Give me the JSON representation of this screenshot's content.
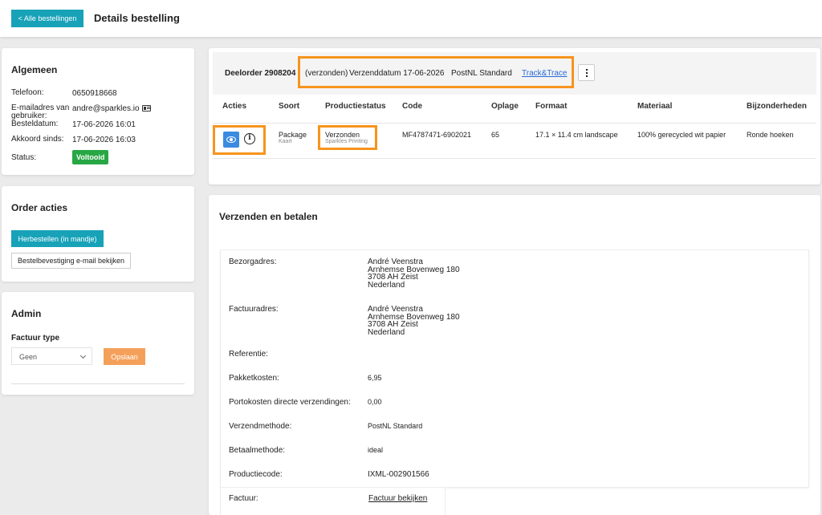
{
  "header": {
    "back_label": "< Alle bestellingen",
    "title": "Details bestelling"
  },
  "algemeen": {
    "title": "Algemeen",
    "telefoon_label": "Telefoon:",
    "telefoon": "0650918668",
    "email_label": "E-mailadres van gebruiker:",
    "email": "andre@sparkles.io",
    "besteldatum_label": "Besteldatum:",
    "besteldatum": "17-06-2026 16:01",
    "akkoord_label": "Akkoord sinds:",
    "akkoord": "17-06-2026 16:03",
    "status_label": "Status:",
    "status": "Voltooid"
  },
  "order_acties": {
    "title": "Order acties",
    "reorder_label": "Herbestellen (in mandje)",
    "confirm_label": "Bestelbevestiging e-mail bekijken"
  },
  "admin": {
    "title": "Admin",
    "factuur_type_label": "Factuur type",
    "factuur_type_value": "Geen",
    "save_label": "Opslaan"
  },
  "deelorder": {
    "title": "Deelorder 2908204",
    "status": "(verzonden)",
    "verzenddatum": "Verzenddatum 17-06-2026",
    "methode": "PostNL Standard",
    "track_label": "Track&Trace",
    "columns": [
      "Acties",
      "Soort",
      "Productiestatus",
      "Code",
      "Oplage",
      "Formaat",
      "Materiaal",
      "Bijzonderheden"
    ],
    "row": {
      "soort": "Package",
      "soort_sub": "Kaart",
      "status": "Verzonden",
      "status_sub": "Sparkles Printing",
      "code": "MF4787471-6902021",
      "oplage": "65",
      "formaat": "17.1 × 11.4 cm landscape",
      "materiaal": "100% gerecycled wit papier",
      "bijzonderheden": "Ronde hoeken"
    }
  },
  "verzenden": {
    "title": "Verzenden en betalen",
    "bezorg_label": "Bezorgadres:",
    "bezorg": [
      "André Veenstra",
      "Arnhemse Bovenweg 180",
      "3708 AH Zeist",
      "Nederland"
    ],
    "factuur_label": "Factuuradres:",
    "factuur": [
      "André Veenstra",
      "Arnhemse Bovenweg 180",
      "3708 AH Zeist",
      "Nederland"
    ],
    "referentie_label": "Referentie:",
    "pakket_label": "Pakketkosten:",
    "pakket": "6,95",
    "porto_label": "Portokosten directe verzendingen:",
    "porto": "0,00",
    "methode_label": "Verzendmethode:",
    "methode": "PostNL Standard",
    "betaal_label": "Betaalmethode:",
    "betaal": "ideal",
    "productiecode_label": "Productiecode:",
    "productiecode": "IXML-002901566",
    "factuurlink_label": "Factuur:",
    "factuurlink": "Factuur bekijken"
  },
  "colors": {
    "accent": "#17a2b8",
    "highlight": "#f7941d",
    "success": "#28a745",
    "orange_button": "#f5a05a",
    "eye_button": "#3b8be0"
  }
}
